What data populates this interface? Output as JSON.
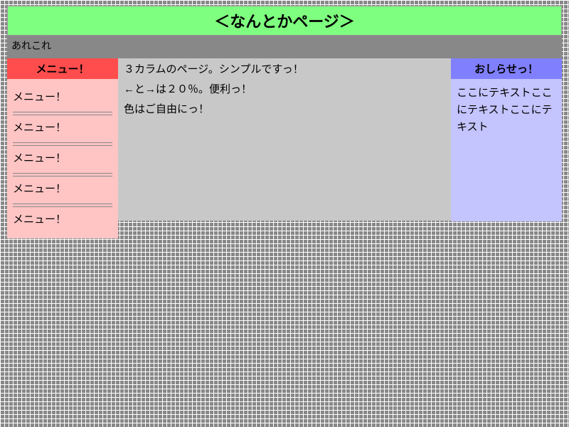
{
  "header": {
    "title": "＜なんとかページ＞",
    "subtitle": "あれこれ"
  },
  "left": {
    "heading": "メニュー！",
    "items": [
      "メニュー！",
      "メニュー！",
      "メニュー！",
      "メニュー！",
      "メニュー！"
    ]
  },
  "center": {
    "lines": [
      "３カラムのページ。シンプルですっ！",
      "←と→は２０％。便利っ！",
      "色はご自由にっ！"
    ]
  },
  "right": {
    "heading": "おしらせっ！",
    "body": "ここにテキストここにテキストここにテキスト"
  }
}
